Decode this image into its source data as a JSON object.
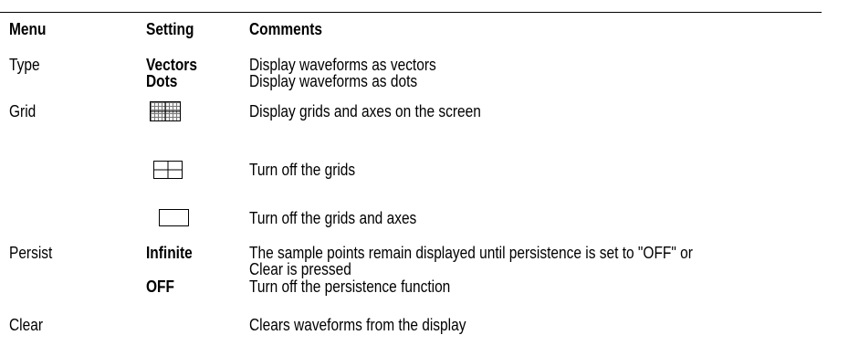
{
  "table": {
    "headers": {
      "menu": "Menu",
      "setting": "Setting",
      "comments": "Comments"
    },
    "type": {
      "menu": "Type",
      "setting_1": "Vectors",
      "comment_1": "Display waveforms as vectors",
      "setting_2": "Dots",
      "comment_2": "Display waveforms as dots"
    },
    "grid": {
      "menu": "Grid",
      "icon_1": "grid-with-axes-icon",
      "comment_1": "Display grids and axes on the screen",
      "icon_2": "axes-only-icon",
      "comment_2": "Turn off the grids",
      "icon_3": "empty-frame-icon",
      "comment_3": "Turn off the grids and axes"
    },
    "persist": {
      "menu": "Persist",
      "setting_1": "Infinite",
      "comment_1_line1": "The sample points remain displayed until persistence is set to \"OFF\" or",
      "comment_1_line2": "Clear is pressed",
      "setting_2": "OFF",
      "comment_2": "Turn off the persistence function"
    },
    "clear": {
      "menu": "Clear",
      "comment": "Clears waveforms from the display"
    }
  }
}
